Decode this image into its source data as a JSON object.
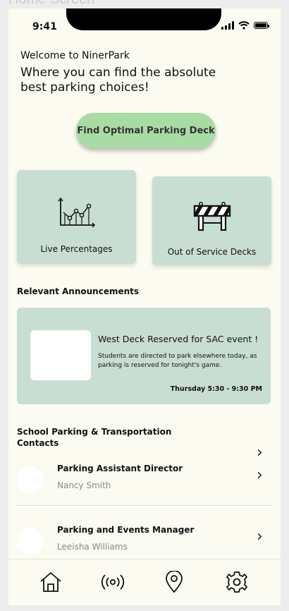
{
  "frame": {
    "title": "Home Screen"
  },
  "status_bar": {
    "time": "9:41"
  },
  "header": {
    "welcome": "Welcome to NinerPark",
    "tagline": "Where you can find the absolute best parking choices!"
  },
  "primary_action": {
    "label": "Find Optimal Parking Deck"
  },
  "cards": {
    "live": {
      "label": "Live Percentages",
      "icon": "line-chart-icon"
    },
    "out_of_service": {
      "label": "Out of Service Decks",
      "icon": "road-barrier-icon"
    }
  },
  "announcements": {
    "section_title": "Relevant Announcements",
    "items": [
      {
        "title": "West Deck Reserved for SAC event !",
        "body": "Students are directed to park elsewhere today, as parking is reserved for tonight's game.",
        "time": "Thursday 5:30 - 9:30 PM"
      }
    ]
  },
  "contacts": {
    "section_title": "School Parking & Transportation Contacts",
    "items": [
      {
        "role": "Parking Assistant Director",
        "name": "Nancy Smith"
      },
      {
        "role": "Parking and Events Manager",
        "name": "Leeisha Williams"
      }
    ]
  },
  "tab_bar": {
    "items": [
      {
        "name": "home",
        "icon": "home-icon"
      },
      {
        "name": "live",
        "icon": "broadcast-icon"
      },
      {
        "name": "map",
        "icon": "location-pin-icon"
      },
      {
        "name": "settings",
        "icon": "gear-icon"
      }
    ]
  },
  "colors": {
    "background": "#fbfbf1",
    "card": "#c9ded2",
    "primary_button": "#a9dca4"
  }
}
